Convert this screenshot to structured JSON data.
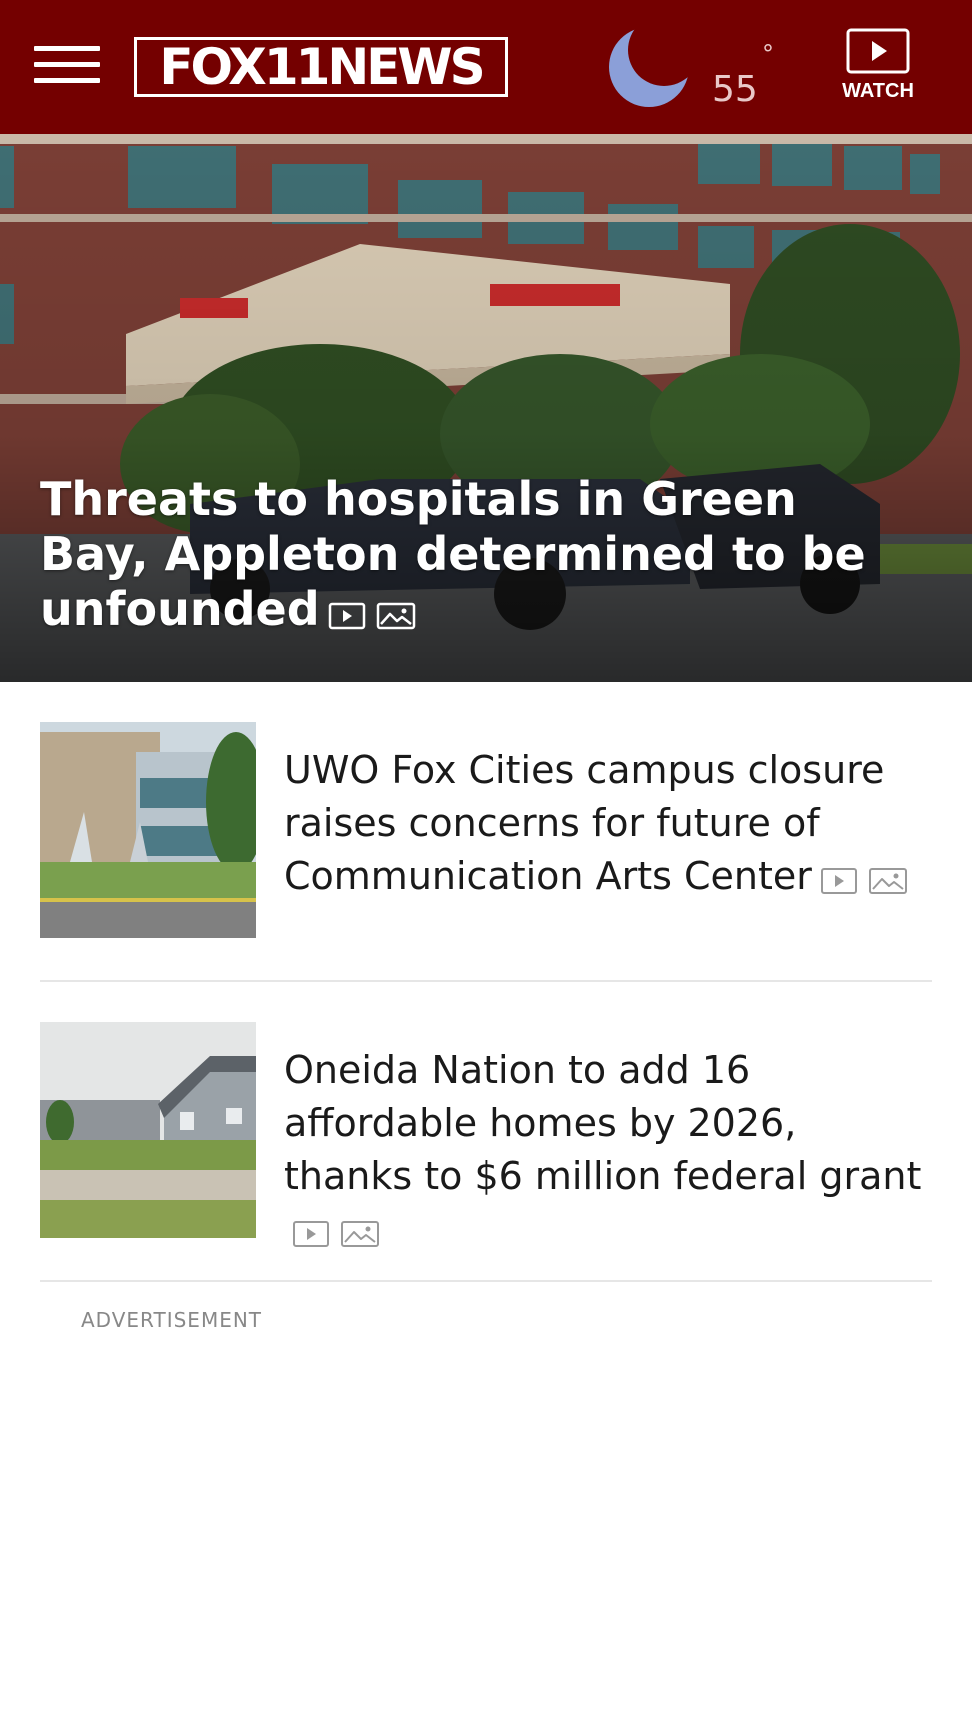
{
  "header": {
    "logo_text": "FOX11NEWS",
    "weather": {
      "icon": "moon-icon",
      "temperature": "55",
      "degree_symbol": "°"
    },
    "watch_label": "WATCH",
    "menu_icon": "hamburger-menu-icon",
    "colors": {
      "background": "#740000",
      "moon": "#8b9fd8"
    }
  },
  "hero": {
    "title": "Threats to hospitals in Green Bay, Appleton determined to be unfounded",
    "media_icons": [
      "video-icon",
      "gallery-icon"
    ]
  },
  "stories": [
    {
      "title": "UWO Fox Cities campus closure raises concerns for future of Communication Arts Center",
      "media_icons": [
        "video-icon",
        "gallery-icon"
      ]
    },
    {
      "title": "Oneida Nation to add 16 affordable homes by 2026, thanks to $6 million federal grant",
      "media_icons": [
        "video-icon",
        "gallery-icon"
      ]
    }
  ],
  "advertisement_label": "ADVERTISEMENT"
}
